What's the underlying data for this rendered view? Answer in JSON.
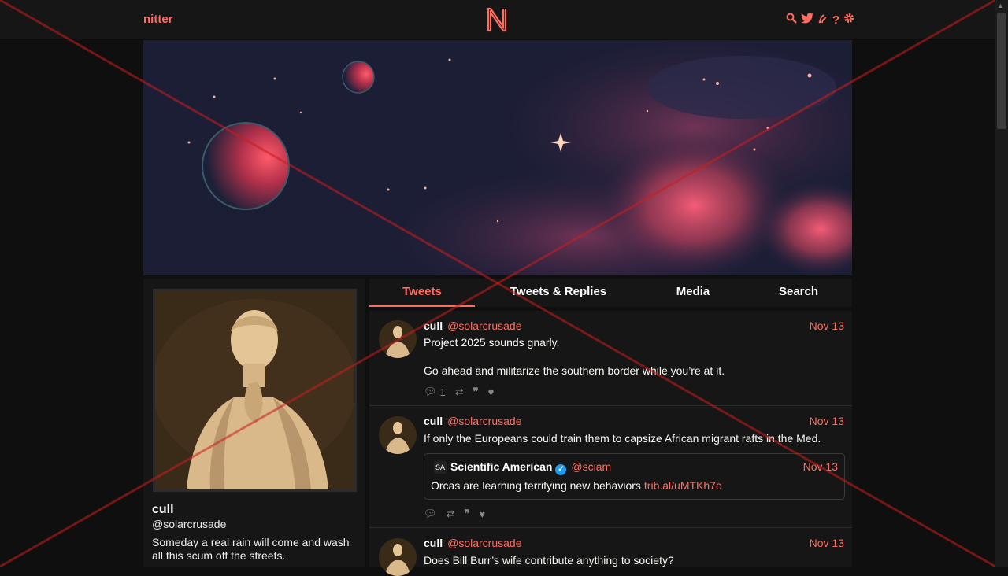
{
  "nav": {
    "brand": "nitter",
    "logo_letter": "N",
    "icons": [
      "search-icon",
      "twitter-bird-icon",
      "rss-icon",
      "help-icon",
      "gear-icon"
    ]
  },
  "profile": {
    "fullname": "cull",
    "username": "@solarcrusade",
    "bio": "Someday a real rain will come and wash all this scum off the streets."
  },
  "tabs": [
    {
      "label": "Tweets",
      "active": true
    },
    {
      "label": "Tweets & Replies",
      "active": false
    },
    {
      "label": "Media",
      "active": false
    },
    {
      "label": "Search",
      "active": false
    }
  ],
  "tweets": [
    {
      "fullname": "cull",
      "username": "@solarcrusade",
      "date": "Nov 13",
      "text_line1": "Project 2025 sounds gnarly.",
      "text_line2": "Go ahead and militarize the southern border while you’re at it.",
      "replies": "1"
    },
    {
      "fullname": "cull",
      "username": "@solarcrusade",
      "date": "Nov 13",
      "text_line1": "If only the Europeans could train them to capsize African migrant rafts in the Med.",
      "quote": {
        "fullname": "Scientific American",
        "username": "@sciam",
        "date": "Nov 13",
        "text": "Orcas are learning terrifying new behaviors",
        "link": "trib.al/uMTKh7o",
        "avatar_text": "SA"
      }
    },
    {
      "fullname": "cull",
      "username": "@solarcrusade",
      "date": "Nov 13",
      "text_line1": "Does Bill Burr’s wife contribute anything to society?"
    }
  ],
  "colors": {
    "accent": "#ff6c60",
    "background": "#0f0f0f",
    "panel": "#161616",
    "overlay_cross": "#c81e1e"
  }
}
